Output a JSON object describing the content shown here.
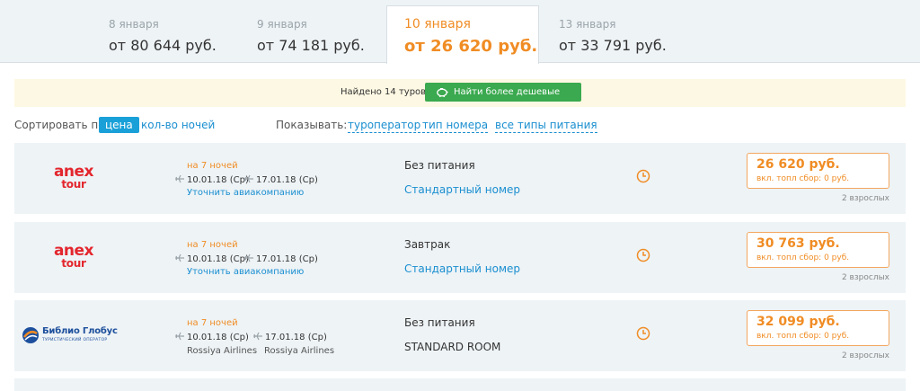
{
  "date_tabs": [
    {
      "date": "8 января",
      "price": "от 80 644 руб."
    },
    {
      "date": "9 января",
      "price": "от 74 181 руб."
    },
    {
      "date": "10 января",
      "price": "от 26 620 руб."
    },
    {
      "date": "13 января",
      "price": "от 33 791 руб."
    }
  ],
  "found": {
    "text": "Найдено 14 туров",
    "cheaper_button": "Найти более дешевые туры",
    "icon": "piggy-bank-icon"
  },
  "sort": {
    "label": "Сортировать по:",
    "price": "цена",
    "nights": "кол-во ночей"
  },
  "show": {
    "label": "Показывать:",
    "filters": [
      "туроператор",
      "тип номера",
      "все типы питания"
    ]
  },
  "tours": [
    {
      "operator": "anex tour",
      "logo_lines": [
        "anex",
        "tour"
      ],
      "nights": "на 7 ночей",
      "depart": "10.01.18 (Ср)",
      "return": "17.01.18 (Ср)",
      "airline_link": "Уточнить авиакомпанию",
      "meal": "Без питания",
      "room": "Стандартный номер",
      "price": "26 620 руб.",
      "fuel": "вкл. топл сбор: 0 руб.",
      "pax": "2 взрослых"
    },
    {
      "operator": "anex tour",
      "logo_lines": [
        "anex",
        "tour"
      ],
      "nights": "на 7 ночей",
      "depart": "10.01.18 (Ср)",
      "return": "17.01.18 (Ср)",
      "airline_link": "Уточнить авиакомпанию",
      "meal": "Завтрак",
      "room": "Стандартный номер",
      "price": "30 763 руб.",
      "fuel": "вкл. топл сбор: 0 руб.",
      "pax": "2 взрослых"
    },
    {
      "operator": "Библио Глобус",
      "logo_sub": "ТУРИСТИЧЕСКИЙ ОПЕРАТОР",
      "nights": "на 7 ночей",
      "depart": "10.01.18 (Ср)",
      "return": "17.01.18 (Ср)",
      "airline_depart": "Rossiya Airlines",
      "airline_return": "Rossiya Airlines",
      "meal": "Без питания",
      "room": "STANDARD ROOM",
      "price": "32 099 руб.",
      "fuel": "вкл. топл сбор: 0 руб.",
      "pax": "2 взрослых"
    }
  ],
  "colors": {
    "accent_orange": "#f08c24",
    "link_blue": "#1a8fd0",
    "button_green": "#3aa94f",
    "anex_red": "#e3262d",
    "biblio_blue": "#1c4f9c"
  }
}
